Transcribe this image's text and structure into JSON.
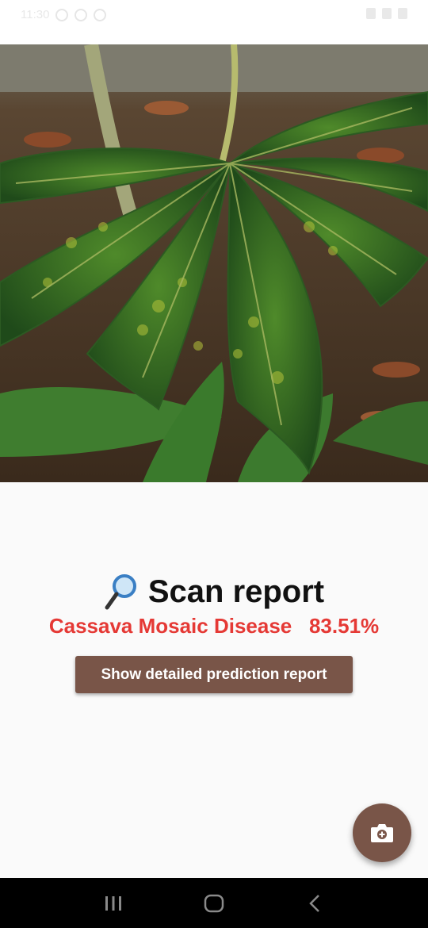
{
  "status_bar": {
    "time": "11:30",
    "icons_left": [
      "notification-icon",
      "alarm-icon",
      "settings-icon"
    ],
    "icons_right": [
      "wifi-icon",
      "signal-icon",
      "battery-icon"
    ]
  },
  "photo": {
    "subject": "cassava-leaf-photo"
  },
  "report": {
    "title_icon": "magnifying-glass-icon",
    "title": "Scan report",
    "prediction_label": "Cassava Mosaic Disease",
    "prediction_confidence": "83.51%",
    "prediction_color": "#e53935",
    "detail_button_label": "Show detailed prediction report"
  },
  "fab": {
    "icon": "camera-icon",
    "color": "#795548"
  },
  "nav_bar": {
    "items": [
      "recent-apps-icon",
      "home-icon",
      "back-icon"
    ]
  },
  "theme": {
    "accent": "#795548",
    "background": "#fafafa"
  }
}
